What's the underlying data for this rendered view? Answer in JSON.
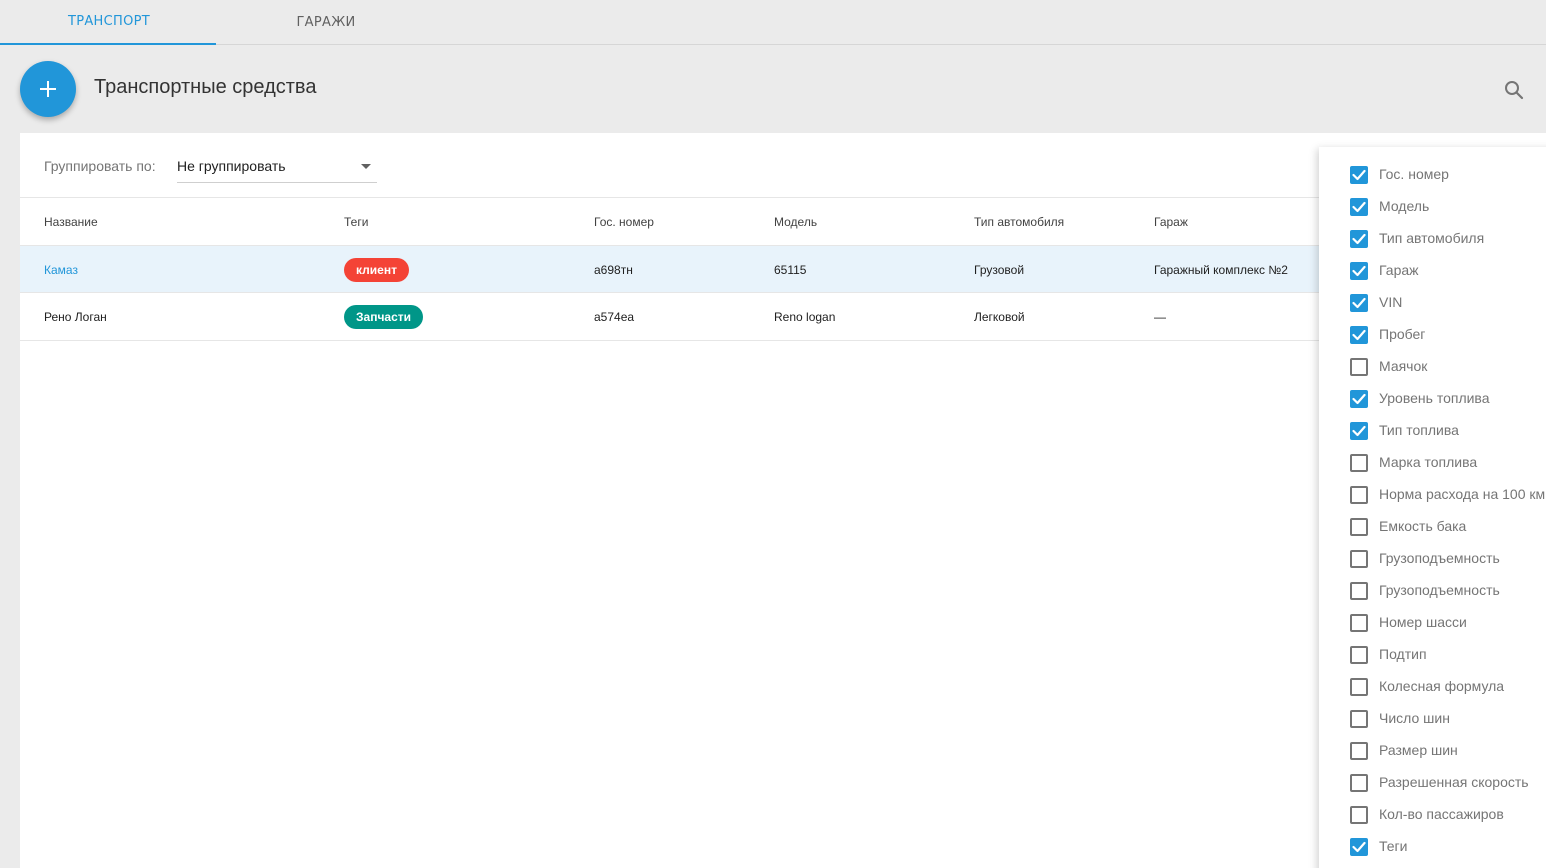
{
  "tabs": [
    {
      "label": "ТРАНСПОРТ",
      "active": true
    },
    {
      "label": "ГАРАЖИ",
      "active": false
    }
  ],
  "header": {
    "add_icon": "plus-icon",
    "title": "Транспортные средства",
    "search_icon": "search-icon"
  },
  "grouping": {
    "label": "Группировать по:",
    "value": "Не группировать"
  },
  "table": {
    "columns": [
      "Название",
      "Теги",
      "Гос. номер",
      "Модель",
      "Тип автомобиля",
      "Гараж"
    ],
    "rows": [
      {
        "name": "Камаз",
        "tag": "клиент",
        "tag_color": "#f44336",
        "plate": "а698тн",
        "model": "65115",
        "type": "Грузовой",
        "garage": "Гаражный комплекс №2",
        "selected": true
      },
      {
        "name": "Рено Логан",
        "tag": "Запчасти",
        "tag_color": "#009688",
        "plate": "а574еа",
        "model": "Reno logan",
        "type": "Легковой",
        "garage": "—",
        "selected": false
      }
    ]
  },
  "column_menu": {
    "items": [
      {
        "label": "Гос. номер",
        "checked": true
      },
      {
        "label": "Модель",
        "checked": true
      },
      {
        "label": "Тип автомобиля",
        "checked": true
      },
      {
        "label": "Гараж",
        "checked": true
      },
      {
        "label": "VIN",
        "checked": true
      },
      {
        "label": "Пробег",
        "checked": true
      },
      {
        "label": "Маячок",
        "checked": false
      },
      {
        "label": "Уровень топлива",
        "checked": true
      },
      {
        "label": "Тип топлива",
        "checked": true
      },
      {
        "label": "Марка топлива",
        "checked": false
      },
      {
        "label": "Норма расхода на 100 км",
        "checked": false
      },
      {
        "label": "Емкость бака",
        "checked": false
      },
      {
        "label": "Грузоподъемность",
        "checked": false
      },
      {
        "label": "Грузоподъемность",
        "checked": false
      },
      {
        "label": "Номер шасси",
        "checked": false
      },
      {
        "label": "Подтип",
        "checked": false
      },
      {
        "label": "Колесная формула",
        "checked": false
      },
      {
        "label": "Число шин",
        "checked": false
      },
      {
        "label": "Размер шин",
        "checked": false
      },
      {
        "label": "Разрешенная скорость",
        "checked": false
      },
      {
        "label": "Кол-во пассажиров",
        "checked": false
      },
      {
        "label": "Теги",
        "checked": true
      }
    ]
  },
  "colors": {
    "accent": "#2196d9",
    "tag_red": "#f44336",
    "tag_teal": "#009688"
  }
}
